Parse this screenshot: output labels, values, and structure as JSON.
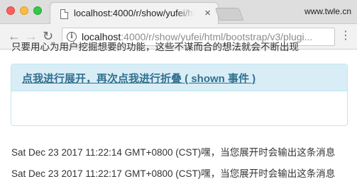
{
  "browser": {
    "tab_title": "localhost:4000/r/show/yufei/ht",
    "tab_close": "×",
    "brand": "www.twle.cn",
    "url_host": "localhost",
    "url_path": ":4000/r/show/yufei/html/bootstrap/v3/plugi...",
    "info_icon": "i",
    "menu_icon": "⋮",
    "back_icon": "←",
    "forward_icon": "→",
    "reload_icon": "↻"
  },
  "panel": {
    "toggle_link": "点我进行展开，再次点我进行折叠 ( shown 事件 )",
    "body_text": "只要用心为用户挖掘想要的功能，这些不谋而合的想法就会不断出现"
  },
  "log": [
    "Sat Dec 23 2017 11:22:14 GMT+0800 (CST)嘿，当您展开时会输出这条消息",
    "Sat Dec 23 2017 11:22:17 GMT+0800 (CST)嘿，当您展开时会输出这条消息"
  ]
}
